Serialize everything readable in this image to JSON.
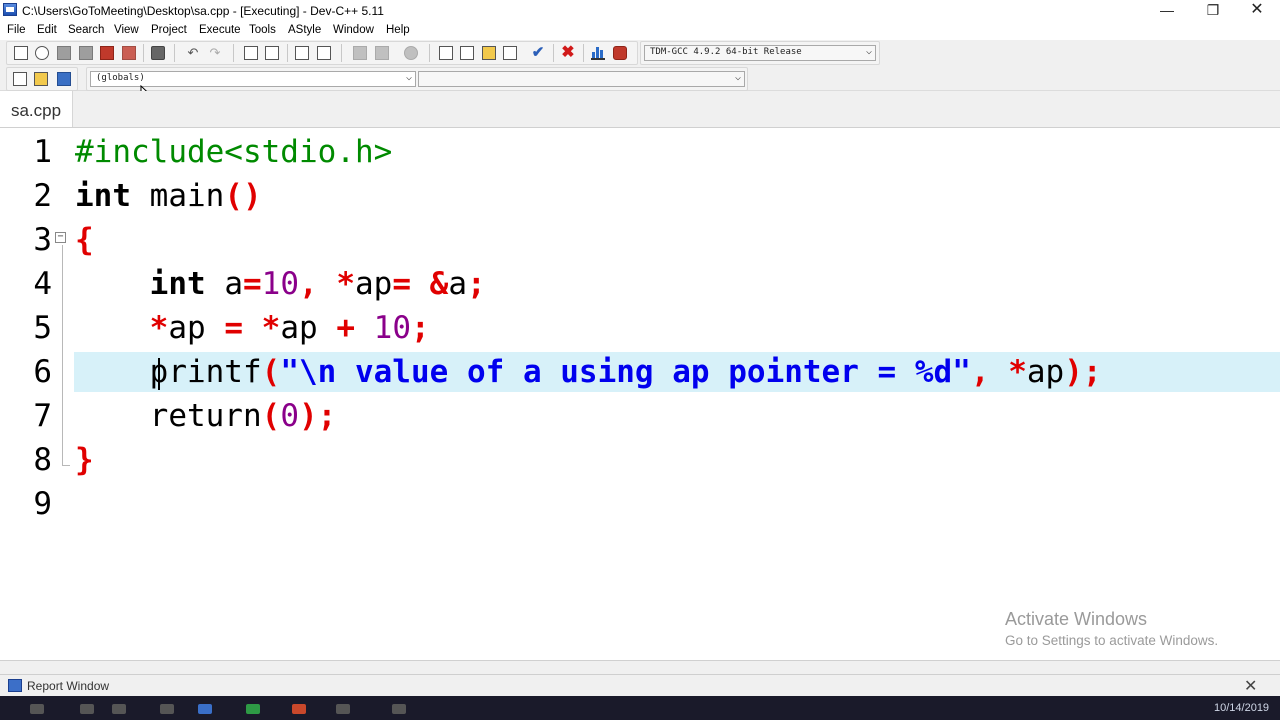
{
  "window": {
    "title": "C:\\Users\\GoToMeeting\\Desktop\\sa.cpp - [Executing] - Dev-C++ 5.11",
    "minimize": "—",
    "maximize": "❐",
    "close": "✕"
  },
  "menu": [
    "File",
    "Edit",
    "Search",
    "View",
    "Project",
    "Execute",
    "Tools",
    "AStyle",
    "Window",
    "Help"
  ],
  "toolbar": {
    "compiler": "TDM-GCC 4.9.2 64-bit Release",
    "scope": "(globals)",
    "member": ""
  },
  "tabs": [
    {
      "label": "sa.cpp"
    }
  ],
  "editor": {
    "active_line": 6,
    "lines": [
      "1",
      "2",
      "3",
      "4",
      "5",
      "6",
      "7",
      "8",
      "9"
    ]
  },
  "code_text": {
    "l1": "#include<stdio.h>",
    "l2_kw": "int",
    "l2_rest": " main",
    "l2_p": "()",
    "l3": "{",
    "l4_kw": "int",
    "l4_a": " a",
    "l4_eq": "=",
    "l4_num": "10",
    "l4_c": ",",
    "l4_star": " *",
    "l4_ap": "ap",
    "l4_eq2": "=",
    "l4_amp": " &",
    "l4_a2": "a",
    "l4_semi": ";",
    "l5_star": "*",
    "l5_ap": "ap",
    "l5_eq": " = ",
    "l5_star2": "*",
    "l5_ap2": "ap",
    "l5_plus": " + ",
    "l5_num": "10",
    "l5_semi": ";",
    "l6_fn": "printf",
    "l6_op": "(",
    "l6_str": "\"\\n value of a using ap pointer = %d\"",
    "l6_c": ",",
    "l6_star": " *",
    "l6_ap": "ap",
    "l6_end": ");",
    "l7_kw": "return",
    "l7_op": "(",
    "l7_num": "0",
    "l7_end": ");",
    "l8": "}"
  },
  "watermark": {
    "title": "Activate Windows",
    "subtitle": "Go to Settings to activate Windows."
  },
  "report_window": {
    "label": "Report Window",
    "close": "✕"
  },
  "taskbar": {
    "clock": "10/14/2019"
  },
  "colors": {
    "preprocessor": "#008a00",
    "operator": "#e00000",
    "number": "#8a008a",
    "string": "#0000ee",
    "active_line": "#d7f1f9"
  }
}
